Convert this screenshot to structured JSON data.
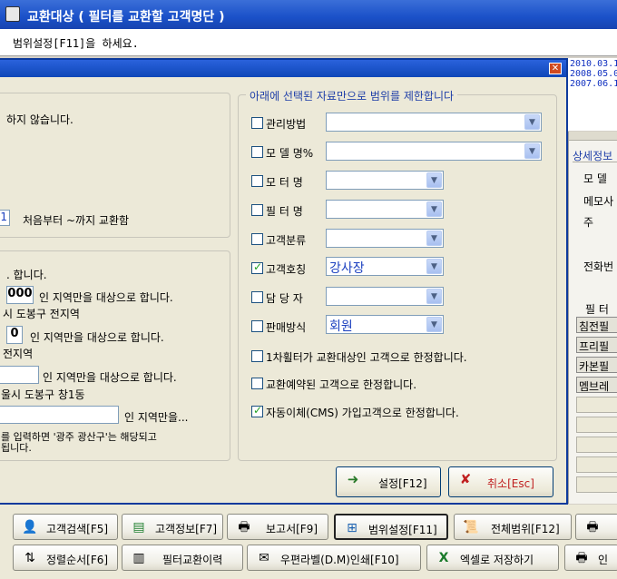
{
  "window": {
    "title": "교환대상 ( 필터를 교환할 고객명단 )",
    "message": "범위설정[F11]을 하세요."
  },
  "right_list": {
    "dates": [
      "2010.03.1",
      "2008.05.0",
      "2007.06.1"
    ],
    "detail_title": "상세정보",
    "labels": [
      "모 델",
      "메모사",
      "주",
      "전화번"
    ],
    "filter_header": "필 터",
    "filters": [
      "침전필",
      "프리필",
      "카본필",
      "멤브레"
    ]
  },
  "dialog": {
    "left_top": {
      "text1": "하지 않습니다.",
      "count_value": "1",
      "count_text": "처음부터 ~까지 교환함"
    },
    "left_bottom": {
      "line1": ". 합니다.",
      "code_value": "000",
      "line2": "인 지역만을 대상으로 합니다.",
      "line3": "시 도봉구 전지역",
      "num_value": "0",
      "line4": "인 지역만을 대상으로 합니다.",
      "line5": "전지역",
      "line6": "인 지역만을 대상으로 합니다.",
      "line7": "울시 도봉구 창1동",
      "line8": "인 지역만을...",
      "line9": "를 입력하면 '광주 광산구'는 해당되고",
      "line10": "됩니다."
    },
    "right_group_title": "아래에 선택된 자료만으로 범위를 제한합니다",
    "filters": [
      {
        "label": "관리방법",
        "checked": false,
        "value": ""
      },
      {
        "label": "모 델 명%",
        "checked": false,
        "value": ""
      },
      {
        "label": "모 터 명",
        "checked": false,
        "value": ""
      },
      {
        "label": "필 터 명",
        "checked": false,
        "value": ""
      },
      {
        "label": "고객분류",
        "checked": false,
        "value": ""
      },
      {
        "label": "고객호칭",
        "checked": true,
        "value": "강사장"
      },
      {
        "label": "담 당 자",
        "checked": false,
        "value": ""
      },
      {
        "label": "판매방식",
        "checked": false,
        "value": "회원"
      }
    ],
    "options": [
      {
        "label": "1차휠터가 교환대상인 고객으로 한정합니다.",
        "checked": false
      },
      {
        "label": "교환예약된 고객으로 한정합니다.",
        "checked": false
      },
      {
        "label": "자동이체(CMS) 가입고객으로 한정합니다.",
        "checked": true
      }
    ],
    "ok_label": "설정[F12]",
    "cancel_label": "취소[Esc]"
  },
  "toolbar": {
    "row1": [
      "고객검색[F5]",
      "고객정보[F7]",
      "보고서[F9]",
      "범위설정[F11]",
      "전체범위[F12]"
    ],
    "row2": [
      "정렬순서[F6]",
      "필터교환이력",
      "우편라벨(D.M)인쇄[F10]",
      "엑셀로 저장하기",
      "인"
    ]
  },
  "colors": {
    "title_bar": "#1a50c8",
    "dialog_face": "#ece9d8",
    "combo_text": "#1a3fbf",
    "group_title": "#1f3fa8"
  }
}
